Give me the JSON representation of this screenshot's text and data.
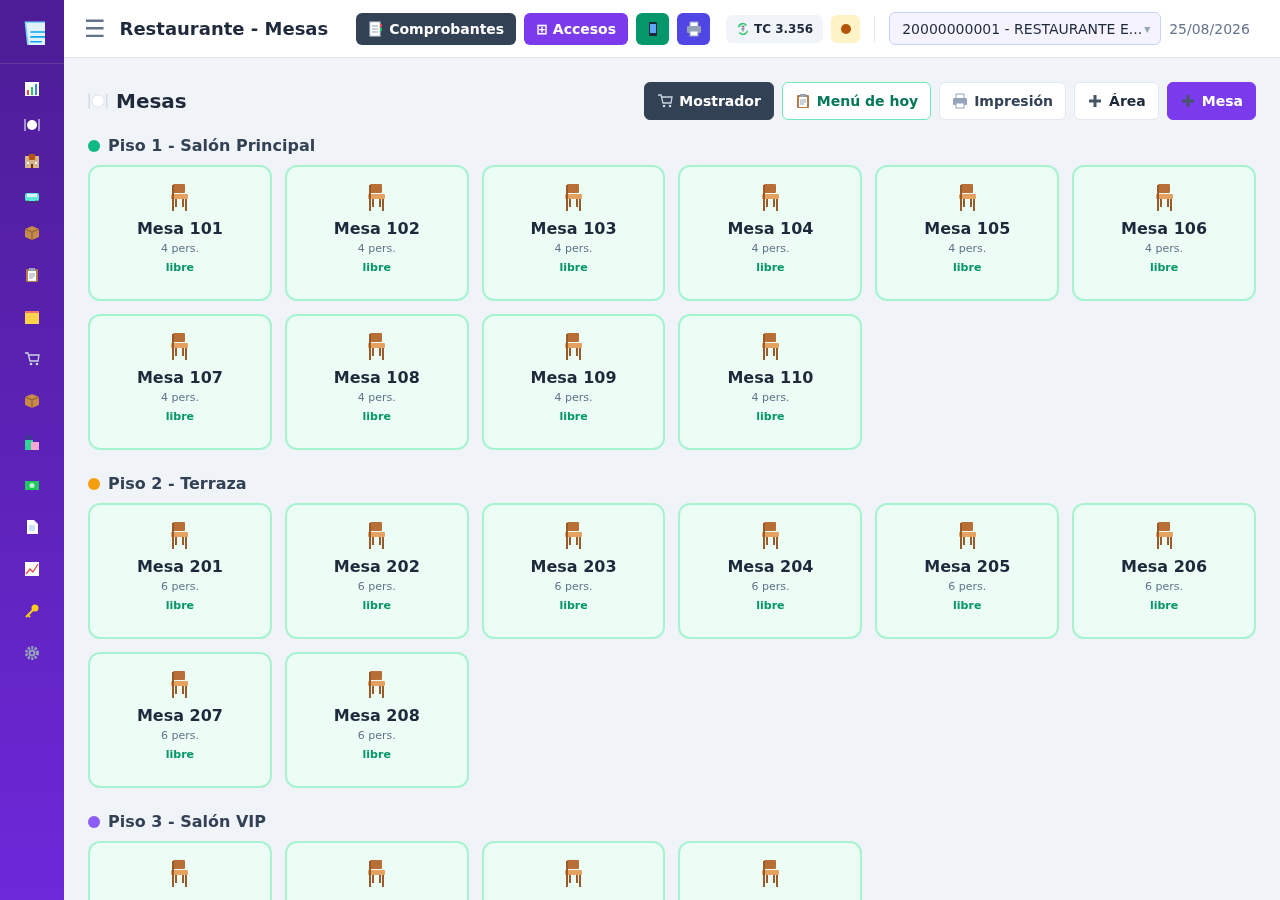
{
  "header": {
    "menu_glyph": "☰",
    "title": "Restaurante - Mesas",
    "buttons": [
      {
        "kind": "dark",
        "label": "Comprobantes"
      },
      {
        "kind": "purple",
        "label": "⊞ Accesos"
      },
      {
        "kind": "green"
      },
      {
        "kind": "indigo"
      }
    ],
    "exchange_rate": "TC 3.356",
    "company": "20000000001 - RESTAURANTE E...",
    "company_caret": "▾",
    "date": "25/08/2026"
  },
  "page": {
    "title": "Mesas",
    "actions": [
      {
        "kind": "dark",
        "label": "Mostrador"
      },
      {
        "kind": "green-outline",
        "label": "Menú de hoy"
      },
      {
        "kind": "light",
        "label": "Impresión"
      },
      {
        "kind": "plain",
        "label": "Área"
      },
      {
        "kind": "primary",
        "label": "Mesa"
      }
    ]
  },
  "areas": [
    {
      "name": "Piso 1 - Salón Principal",
      "color": "#10b981",
      "tables": [
        {
          "name": "Mesa 101",
          "capacity": "4 pers.",
          "status": "libre",
          "free": true
        },
        {
          "name": "Mesa 102",
          "capacity": "4 pers.",
          "status": "libre",
          "free": true
        },
        {
          "name": "Mesa 103",
          "capacity": "4 pers.",
          "status": "libre",
          "free": true
        },
        {
          "name": "Mesa 104",
          "capacity": "4 pers.",
          "status": "libre",
          "free": true
        },
        {
          "name": "Mesa 105",
          "capacity": "4 pers.",
          "status": "libre",
          "free": true
        },
        {
          "name": "Mesa 106",
          "capacity": "4 pers.",
          "status": "libre",
          "free": true
        },
        {
          "name": "Mesa 107",
          "capacity": "4 pers.",
          "status": "libre",
          "free": true
        },
        {
          "name": "Mesa 108",
          "capacity": "4 pers.",
          "status": "libre",
          "free": true
        },
        {
          "name": "Mesa 109",
          "capacity": "4 pers.",
          "status": "libre",
          "free": true
        },
        {
          "name": "Mesa 110",
          "capacity": "4 pers.",
          "status": "libre",
          "free": true
        }
      ]
    },
    {
      "name": "Piso 2 - Terraza",
      "color": "#f59e0b",
      "tables": [
        {
          "name": "Mesa 201",
          "capacity": "6 pers.",
          "status": "libre",
          "free": true
        },
        {
          "name": "Mesa 202",
          "capacity": "6 pers.",
          "status": "libre",
          "free": true
        },
        {
          "name": "Mesa 203",
          "capacity": "6 pers.",
          "status": "libre",
          "free": true
        },
        {
          "name": "Mesa 204",
          "capacity": "6 pers.",
          "status": "libre",
          "free": true
        },
        {
          "name": "Mesa 205",
          "capacity": "6 pers.",
          "status": "libre",
          "free": true
        },
        {
          "name": "Mesa 206",
          "capacity": "6 pers.",
          "status": "libre",
          "free": true
        },
        {
          "name": "Mesa 207",
          "capacity": "6 pers.",
          "status": "libre",
          "free": true
        },
        {
          "name": "Mesa 208",
          "capacity": "6 pers.",
          "status": "libre",
          "free": true
        }
      ]
    },
    {
      "name": "Piso 3 - Salón VIP",
      "color": "#8b5cf6",
      "tables": [
        {
          "free": true
        },
        {
          "free": true
        },
        {
          "free": true
        },
        {
          "free": true
        }
      ]
    }
  ]
}
